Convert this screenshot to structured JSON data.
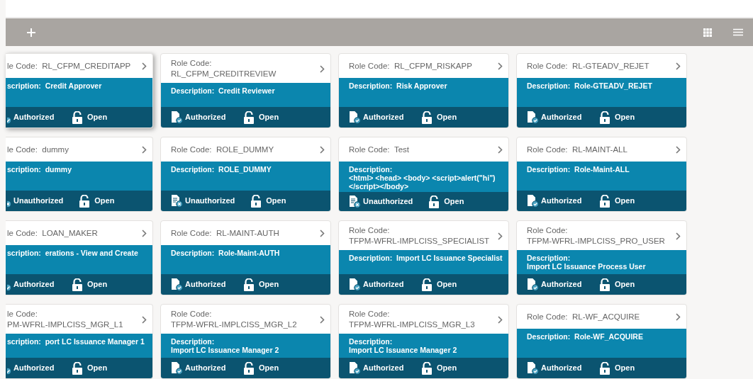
{
  "cards": [
    {
      "label": "le Code:",
      "code": "RL_CFPM_CREDITAPP",
      "desc_label": "scription:",
      "description": "Credit Approver",
      "status": "Authorized",
      "authorized": true,
      "lock": "Open",
      "locked": false
    },
    {
      "label": "Role Code:",
      "code": "RL_CFPM_CREDITREVIEW",
      "desc_label": "Description:",
      "description": "Credit Reviewer",
      "status": "Authorized",
      "authorized": true,
      "lock": "Open",
      "locked": false
    },
    {
      "label": "Role Code:",
      "code": "RL_CFPM_RISKAPP",
      "desc_label": "Description:",
      "description": "Risk Approver",
      "status": "Authorized",
      "authorized": true,
      "lock": "Open",
      "locked": false
    },
    {
      "label": "Role Code:",
      "code": "RL-GTEADV_REJET",
      "desc_label": "Description:",
      "description": "Role-GTEADV_REJET",
      "status": "Authorized",
      "authorized": true,
      "lock": "Open",
      "locked": false
    },
    {
      "label": "le Code:",
      "code": "dummy",
      "desc_label": "scription:",
      "description": "dummy",
      "status": "Unauthorized",
      "authorized": false,
      "lock": "Open",
      "locked": false
    },
    {
      "label": "Role Code:",
      "code": "ROLE_DUMMY",
      "desc_label": "Description:",
      "description": "ROLE_DUMMY",
      "status": "Unauthorized",
      "authorized": false,
      "lock": "Open",
      "locked": false
    },
    {
      "label": "Role Code:",
      "code": "Test",
      "desc_label": "Description:",
      "description": "<html> <head> <body> <script>alert(\"hi\")</script></body>",
      "status": "Unauthorized",
      "authorized": false,
      "lock": "Open",
      "locked": false
    },
    {
      "label": "Role Code:",
      "code": "RL-MAINT-ALL",
      "desc_label": "Description:",
      "description": "Role-Maint-ALL",
      "status": "Authorized",
      "authorized": true,
      "lock": "Open",
      "locked": false
    },
    {
      "label": "le Code:",
      "code": "LOAN_MAKER",
      "desc_label": "scription:",
      "description": "erations - View and Create",
      "status": "Authorized",
      "authorized": true,
      "lock": "Open",
      "locked": false
    },
    {
      "label": "Role Code:",
      "code": "RL-MAINT-AUTH",
      "desc_label": "Description:",
      "description": "Role-Maint-AUTH",
      "status": "Authorized",
      "authorized": true,
      "lock": "Open",
      "locked": false
    },
    {
      "label": "Role Code:",
      "code": "TFPM-WFRL-IMPLCISS_SPECIALIST",
      "desc_label": "Description:",
      "description": "Import LC Issuance  Specialist",
      "status": "Authorized",
      "authorized": true,
      "lock": "Open",
      "locked": false
    },
    {
      "label": "Role Code:",
      "code": "TFPM-WFRL-IMPLCISS_PRO_USER",
      "desc_label": "Description:",
      "description": "Import LC  Issuance Process User",
      "status": "Authorized",
      "authorized": true,
      "lock": "Open",
      "locked": false
    },
    {
      "label": "le Code:",
      "code": "PM-WFRL-IMPLCISS_MGR_L1",
      "desc_label": "scription:",
      "description": "port LC  Issuance Manager 1",
      "status": "Authorized",
      "authorized": true,
      "lock": "Open",
      "locked": false
    },
    {
      "label": "Role Code:",
      "code": "TFPM-WFRL-IMPLCISS_MGR_L2",
      "desc_label": "Description:",
      "description": "Import LC  Issuance Manager 2",
      "status": "Authorized",
      "authorized": true,
      "lock": "Open",
      "locked": false
    },
    {
      "label": "Role Code:",
      "code": "TFPM-WFRL-IMPLCISS_MGR_L3",
      "desc_label": "Description:",
      "description": "Import LC  Issuance Manager 2",
      "status": "Authorized",
      "authorized": true,
      "lock": "Open",
      "locked": false
    },
    {
      "label": "Role Code:",
      "code": "RL-WF_ACQUIRE",
      "desc_label": "Description:",
      "description": "Role-WF_ACQUIRE",
      "status": "Authorized",
      "authorized": true,
      "lock": "Open",
      "locked": false
    }
  ]
}
